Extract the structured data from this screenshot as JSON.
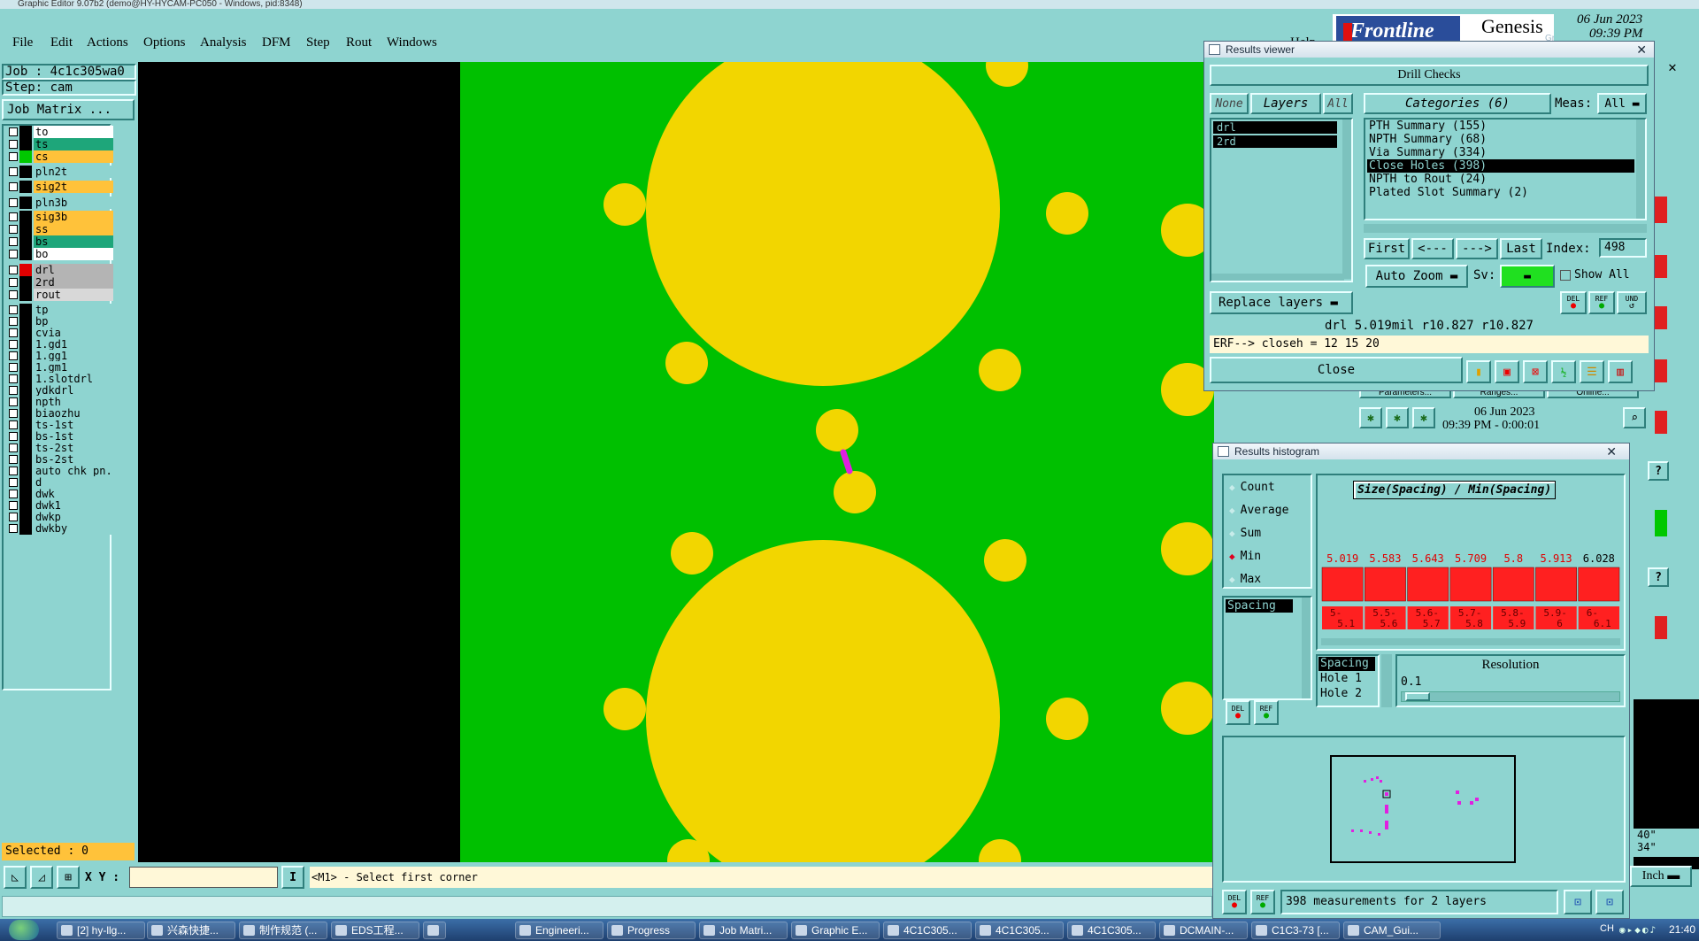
{
  "window": {
    "title": "Graphic Editor 9.07b2 (demo@HY-HYCAM-PC050 - Windows, pid:8348)",
    "help": "Help",
    "brand": "Frontline",
    "product": "Genesis 2000",
    "date": "06 Jun 2023",
    "time": "09:39 PM",
    "ghost_label": "Graphic Editor"
  },
  "menu": [
    "File",
    "Edit",
    "Actions",
    "Options",
    "Analysis",
    "DFM",
    "Step",
    "Rout",
    "Windows"
  ],
  "left": {
    "job": "Job : 4c1c305wa0",
    "step": "Step: cam",
    "job_matrix": "Job Matrix ...",
    "selected": "Selected : 0",
    "layers": [
      {
        "name": "to",
        "bg": "#ffffff",
        "color": "#000000"
      },
      {
        "name": "ts",
        "bg": "#1ea67a",
        "color": "#000000"
      },
      {
        "name": "cs",
        "bg": "#ffc23a",
        "color": "#00c800"
      },
      {
        "name": "pln2t",
        "bg": "#8ed4d0",
        "color": "#000000"
      },
      {
        "name": "sig2t",
        "bg": "#ffc23a",
        "color": "#000000"
      },
      {
        "name": "pln3b",
        "bg": "#8ed4d0",
        "color": "#000000"
      },
      {
        "name": "sig3b",
        "bg": "#ffc23a",
        "color": "#000000"
      },
      {
        "name": "ss",
        "bg": "#ffc23a",
        "color": "#000000"
      },
      {
        "name": "bs",
        "bg": "#1ea67a",
        "color": "#000000"
      },
      {
        "name": "bo",
        "bg": "#ffffff",
        "color": "#000000"
      },
      {
        "name": "drl",
        "bg": "#b4b4b4",
        "color": "#e00000"
      },
      {
        "name": "2rd",
        "bg": "#b4b4b4",
        "color": "#000000"
      },
      {
        "name": "rout",
        "bg": "#d8d8d8",
        "color": "#000000"
      },
      {
        "name": "tp",
        "bg": "#8ed4d0",
        "color": "#000000"
      },
      {
        "name": "bp",
        "bg": "#8ed4d0",
        "color": "#000000"
      },
      {
        "name": "cvia",
        "bg": "#8ed4d0",
        "color": "#000000"
      },
      {
        "name": "1.gd1",
        "bg": "#8ed4d0",
        "color": "#000000"
      },
      {
        "name": "1.gg1",
        "bg": "#8ed4d0",
        "color": "#000000"
      },
      {
        "name": "1.gm1",
        "bg": "#8ed4d0",
        "color": "#000000"
      },
      {
        "name": "1.slotdrl",
        "bg": "#8ed4d0",
        "color": "#000000"
      },
      {
        "name": "ydkdrl",
        "bg": "#8ed4d0",
        "color": "#000000"
      },
      {
        "name": "npth",
        "bg": "#8ed4d0",
        "color": "#000000"
      },
      {
        "name": "biaozhu",
        "bg": "#8ed4d0",
        "color": "#000000"
      },
      {
        "name": "ts-1st",
        "bg": "#8ed4d0",
        "color": "#000000"
      },
      {
        "name": "bs-1st",
        "bg": "#8ed4d0",
        "color": "#000000"
      },
      {
        "name": "ts-2st",
        "bg": "#8ed4d0",
        "color": "#000000"
      },
      {
        "name": "bs-2st",
        "bg": "#8ed4d0",
        "color": "#000000"
      },
      {
        "name": "auto_chk_pn.",
        "bg": "#8ed4d0",
        "color": "#000000"
      },
      {
        "name": "d",
        "bg": "#8ed4d0",
        "color": "#000000"
      },
      {
        "name": "dwk",
        "bg": "#8ed4d0",
        "color": "#000000"
      },
      {
        "name": "dwk1",
        "bg": "#8ed4d0",
        "color": "#000000"
      },
      {
        "name": "dwkp",
        "bg": "#8ed4d0",
        "color": "#000000"
      },
      {
        "name": "dwkby",
        "bg": "#8ed4d0",
        "color": "#000000"
      }
    ]
  },
  "bottom": {
    "xy_label": "X Y :",
    "xy_value": "",
    "prompt": "<M1> - Select first corner"
  },
  "results_viewer": {
    "title": "Results viewer",
    "header": "Drill Checks",
    "none": "None",
    "layers": "Layers",
    "all": "All",
    "layer_list": [
      "drl",
      "2rd"
    ],
    "categories": "Categories (6)",
    "meas_label": "Meas:",
    "meas_value": "All",
    "category_list": [
      "PTH Summary (155)",
      "NPTH Summary (68)",
      "Via Summary (334)",
      "Close Holes (398)",
      "NPTH to Rout (24)",
      "Plated Slot Summary (2)"
    ],
    "first": "First",
    "prev": "<---",
    "next": "--->",
    "last": "Last",
    "index_label": "Index:",
    "index_value": "498",
    "auto_zoom": "Auto Zoom",
    "sv_label": "Sv:",
    "show_all": "Show All",
    "replace_layers": "Replace layers",
    "del": "DEL",
    "ref": "REF",
    "und": "UND",
    "info": "drl 5.019mil  r10.827  r10.827",
    "erf": "ERF--> closeh = 12 15 20",
    "close": "Close"
  },
  "behind": {
    "tabs": [
      "Parameters...",
      "Ranges...",
      "Online..."
    ],
    "date": "06 Jun 2023",
    "time": "09:39 PM - 0:00:01",
    "coords": [
      "40\"",
      "34\""
    ],
    "units": "Inch"
  },
  "histogram": {
    "title": "Results histogram",
    "options": [
      "Count",
      "Average",
      "Sum",
      "Min",
      "Max"
    ],
    "selected_option": "Min",
    "list_item": "Spacing",
    "chart_title": "Size(Spacing) / Min(Spacing)",
    "del": "DEL",
    "ref": "REF",
    "fields": [
      "Spacing",
      "Hole 1",
      "Hole 2"
    ],
    "resolution_label": "Resolution",
    "resolution_value": "0.1",
    "footer": "398 measurements for 2 layers",
    "chart_data": {
      "type": "bar",
      "categories": [
        "5-5.1",
        "5.5-5.6",
        "5.6-5.7",
        "5.7-5.8",
        "5.8-5.9",
        "5.9-6",
        "6-6.1"
      ],
      "values": [
        5.019,
        5.583,
        5.643,
        5.709,
        5.8,
        5.913,
        6.028
      ],
      "value_labels": [
        "5.019",
        "5.583",
        "5.643",
        "5.709",
        "5.8",
        "5.913",
        "6.028"
      ],
      "bin_labels": [
        [
          "5-",
          "5.1"
        ],
        [
          "5.5-",
          "5.6"
        ],
        [
          "5.6-",
          "5.7"
        ],
        [
          "5.7-",
          "5.8"
        ],
        [
          "5.8-",
          "5.9"
        ],
        [
          "5.9-",
          "6"
        ],
        [
          "6-",
          "6.1"
        ]
      ],
      "title": "Size(Spacing) / Min(Spacing)",
      "bar_color": "#ff2020"
    }
  },
  "taskbar": {
    "tasks": [
      "[2] hy-llg...",
      "兴森快捷...",
      "制作规范 (...",
      "EDS工程...",
      "",
      "Engineeri...",
      "Progress",
      "Job Matri...",
      "Graphic E...",
      "4C1C305...",
      "4C1C305...",
      "4C1C305...",
      "DCMAIN-...",
      "C1C3-73 [...",
      "CAM_Gui..."
    ],
    "lang": "CH",
    "clock": "21:40"
  },
  "colors": {
    "panel": "#8ed4d0",
    "board": "#00c000",
    "pad": "#f2d600",
    "highlight": "#e020e0"
  }
}
